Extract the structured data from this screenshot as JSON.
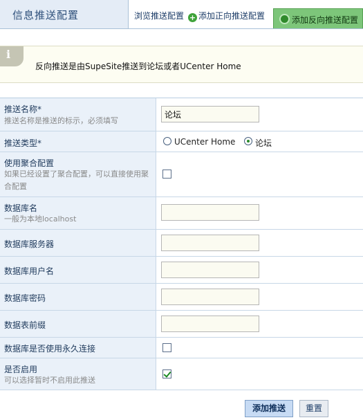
{
  "header": {
    "title": "信息推送配置",
    "tabs": {
      "browse": "浏览推送配置",
      "add_forward": "添加正向推送配置",
      "add_reverse": "添加反向推送配置"
    }
  },
  "info": {
    "icon": "info-icon",
    "message": "反向推送是由SupeSite推送到论坛或者UCenter Home"
  },
  "form": {
    "push_name": {
      "label": "推送名称*",
      "desc": "推送名称是推送的标示，必须填写",
      "value": "论坛"
    },
    "push_type": {
      "label": "推送类型*",
      "options": [
        "UCenter Home",
        "论坛"
      ],
      "selected": "论坛"
    },
    "use_aggregate": {
      "label": "使用聚合配置",
      "desc": "如果已经设置了聚合配置，可以直接使用聚合配置",
      "checked": false
    },
    "db_name": {
      "label": "数据库名",
      "desc": "一般为本地localhost",
      "value": ""
    },
    "db_server": {
      "label": "数据库服务器",
      "value": ""
    },
    "db_user": {
      "label": "数据库用户名",
      "value": ""
    },
    "db_password": {
      "label": "数据库密码",
      "value": ""
    },
    "table_prefix": {
      "label": "数据表前缀",
      "value": ""
    },
    "persistent": {
      "label": "数据库是否使用永久连接",
      "checked": false
    },
    "enabled": {
      "label": "是否启用",
      "desc": "可以选择暂时不启用此推送",
      "checked": true
    }
  },
  "buttons": {
    "submit": "添加推送",
    "reset": "重置"
  },
  "colors": {
    "active_tab": "#7dc67a",
    "label_bg": "#eaf1f9",
    "header_bg": "#e4ecf6"
  }
}
